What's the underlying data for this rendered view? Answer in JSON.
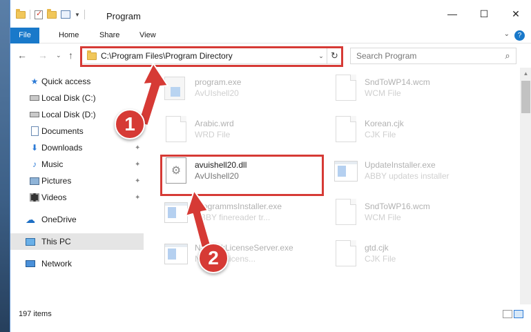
{
  "window": {
    "title": "Program",
    "minimize_glyph": "—",
    "maximize_glyph": "☐",
    "close_glyph": "✕"
  },
  "ribbon": {
    "tabs": [
      "File",
      "Home",
      "Share",
      "View"
    ],
    "help_glyph": "?",
    "chevron_glyph": "⌄",
    "accent": "#1979ca"
  },
  "nav": {
    "back_glyph": "←",
    "forward_glyph": "→",
    "dropdown_glyph": "⌄",
    "up_glyph": "↑",
    "address": "C:\\Program Files\\Program Directory",
    "address_dropdown_glyph": "⌄",
    "refresh_glyph": "↻",
    "search_placeholder": "Search Program",
    "search_glyph": "⌕"
  },
  "sidebar": {
    "items": [
      {
        "label": "Quick access",
        "icon": "star-icon",
        "glyph": "★",
        "pinned": false
      },
      {
        "label": "Local Disk (C:)",
        "icon": "drive-icon",
        "pinned": false
      },
      {
        "label": "Local Disk (D:)",
        "icon": "drive-icon",
        "pinned": false
      },
      {
        "label": "Documents",
        "icon": "documents-icon",
        "pinned": false
      },
      {
        "label": "Downloads",
        "icon": "downloads-icon",
        "glyph": "⬇",
        "pinned": true
      },
      {
        "label": "Music",
        "icon": "music-icon",
        "glyph": "♪",
        "pinned": true
      },
      {
        "label": "Pictures",
        "icon": "pictures-icon",
        "pinned": true
      },
      {
        "label": "Videos",
        "icon": "videos-icon",
        "pinned": true
      },
      {
        "label": "OneDrive",
        "icon": "onedrive-icon",
        "glyph": "☁",
        "pinned": false
      },
      {
        "label": "This PC",
        "icon": "pc-icon",
        "pinned": false,
        "selected": true
      },
      {
        "label": "Network",
        "icon": "network-icon",
        "pinned": false
      }
    ],
    "pin_glyph": "📌"
  },
  "files": [
    {
      "name": "program.exe",
      "desc": "AvUIshell20",
      "icon": "program-icon",
      "faded": true
    },
    {
      "name": "SndToWP14.wcm",
      "desc": "WCM File",
      "icon": "document-icon",
      "faded": true
    },
    {
      "name": "Arabic.wrd",
      "desc": "WRD File",
      "icon": "document-icon",
      "faded": true
    },
    {
      "name": "Korean.cjk",
      "desc": "CJK File",
      "icon": "document-icon",
      "faded": true
    },
    {
      "name": "avuishell20.dll",
      "desc": "AvUIshell20",
      "icon": "dll-gear-icon",
      "faded": false
    },
    {
      "name": "UpdateInstaller.exe",
      "desc": "ABBY updates installer",
      "icon": "exe-icon",
      "faded": true
    },
    {
      "name": "ProgrammsInstaller.exe",
      "desc": "ABBY finereader tr...",
      "icon": "exe-icon",
      "faded": true
    },
    {
      "name": "SndToWP16.wcm",
      "desc": "WCM File",
      "icon": "document-icon",
      "faded": true
    },
    {
      "name": "NetworkLicenseServer.exe",
      "desc": "Network licens...",
      "icon": "exe-icon",
      "faded": true
    },
    {
      "name": "gtd.cjk",
      "desc": "CJK File",
      "icon": "document-icon",
      "faded": true
    }
  ],
  "dll_gear_glyph": "⚙",
  "status": {
    "items": "197 items"
  },
  "annotations": {
    "badge1": "1",
    "badge2": "2",
    "color": "#d63a35"
  }
}
